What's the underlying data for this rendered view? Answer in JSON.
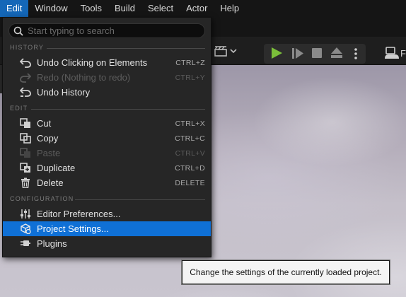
{
  "menubar": {
    "items": [
      "Edit",
      "Window",
      "Tools",
      "Build",
      "Select",
      "Actor",
      "Help"
    ],
    "active_index": 0
  },
  "search": {
    "placeholder": "Start typing to search",
    "value": ""
  },
  "sections": {
    "history": "HISTORY",
    "edit": "EDIT",
    "configuration": "CONFIGURATION"
  },
  "history_items": [
    {
      "icon": "undo-icon",
      "label": "Undo Clicking on Elements",
      "shortcut": "CTRL+Z",
      "enabled": true
    },
    {
      "icon": "redo-icon",
      "label": "Redo (Nothing to redo)",
      "shortcut": "CTRL+Y",
      "enabled": false
    },
    {
      "icon": "undo-history-icon",
      "label": "Undo History",
      "shortcut": "",
      "enabled": true
    }
  ],
  "edit_items": [
    {
      "icon": "cut-icon",
      "label": "Cut",
      "shortcut": "CTRL+X",
      "enabled": true
    },
    {
      "icon": "copy-icon",
      "label": "Copy",
      "shortcut": "CTRL+C",
      "enabled": true
    },
    {
      "icon": "paste-icon",
      "label": "Paste",
      "shortcut": "CTRL+V",
      "enabled": false
    },
    {
      "icon": "duplicate-icon",
      "label": "Duplicate",
      "shortcut": "CTRL+D",
      "enabled": true
    },
    {
      "icon": "trash-icon",
      "label": "Delete",
      "shortcut": "DELETE",
      "enabled": true
    }
  ],
  "config_items": [
    {
      "icon": "sliders-icon",
      "label": "Editor Preferences...",
      "shortcut": "",
      "enabled": true
    },
    {
      "icon": "project-settings-icon",
      "label": "Project Settings...",
      "shortcut": "",
      "enabled": true,
      "highlighted": true
    },
    {
      "icon": "plugin-icon",
      "label": "Plugins",
      "shortcut": "",
      "enabled": true
    }
  ],
  "toolbar": {
    "platforms_label": "F"
  },
  "tooltip": {
    "text": "Change the settings of the currently loaded project."
  },
  "colors": {
    "accent": "#1467b8",
    "highlight": "#0f70d6",
    "play_green": "#7bbf3a"
  }
}
